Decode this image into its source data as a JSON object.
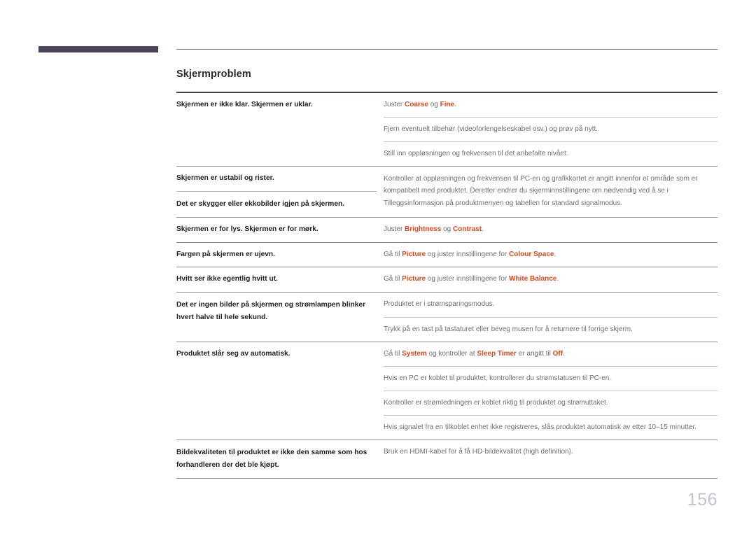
{
  "header": {
    "accent_bar_color": "#4b4259",
    "rule_color": "#7d7d83"
  },
  "page": {
    "title": "Skjermproblem",
    "number": "156",
    "highlight_color": "#e0471b"
  },
  "table": {
    "groups": [
      {
        "questions": [
          "Skjermen er ikke klar. Skjermen er uklar."
        ],
        "answers": [
          [
            {
              "t": "Juster ",
              "hl": false
            },
            {
              "t": "Coarse",
              "hl": true
            },
            {
              "t": " og ",
              "hl": false
            },
            {
              "t": "Fine",
              "hl": true
            },
            {
              "t": ".",
              "hl": false
            }
          ],
          [
            {
              "t": "Fjern eventuelt tilbehør (videoforlengelseskabel osv.) og prøv på nytt.",
              "hl": false
            }
          ],
          [
            {
              "t": "Still inn oppløsningen og frekvensen til det anbefalte nivået.",
              "hl": false
            }
          ]
        ]
      },
      {
        "questions": [
          "Skjermen er ustabil og rister.",
          "Det er skygger eller ekkobilder igjen på skjermen."
        ],
        "answers": [
          [
            {
              "t": "Kontroller at oppløsningen og frekvensen til PC-en og grafikkortet er angitt innenfor et område som er kompatibelt med produktet. Deretter endrer du skjerminnstillingene om nødvendig ved å se i Tilleggsinformasjon på produktmenyen og tabellen for standard signalmodus.",
              "hl": false
            }
          ]
        ]
      },
      {
        "questions": [
          "Skjermen er for lys. Skjermen er for mørk."
        ],
        "answers": [
          [
            {
              "t": "Juster ",
              "hl": false
            },
            {
              "t": "Brightness",
              "hl": true
            },
            {
              "t": " og ",
              "hl": false
            },
            {
              "t": "Contrast",
              "hl": true
            },
            {
              "t": ".",
              "hl": false
            }
          ]
        ]
      },
      {
        "questions": [
          "Fargen på skjermen er ujevn."
        ],
        "answers": [
          [
            {
              "t": "Gå til ",
              "hl": false
            },
            {
              "t": "Picture",
              "hl": true
            },
            {
              "t": " og juster innstillingene for ",
              "hl": false
            },
            {
              "t": "Colour Space",
              "hl": true
            },
            {
              "t": ".",
              "hl": false
            }
          ]
        ]
      },
      {
        "questions": [
          "Hvitt ser ikke egentlig hvitt ut."
        ],
        "answers": [
          [
            {
              "t": "Gå til ",
              "hl": false
            },
            {
              "t": "Picture",
              "hl": true
            },
            {
              "t": " og juster innstillingene for ",
              "hl": false
            },
            {
              "t": "White Balance",
              "hl": true
            },
            {
              "t": ".",
              "hl": false
            }
          ]
        ]
      },
      {
        "questions": [
          "Det er ingen bilder på skjermen og strømlampen blinker hvert halve til hele sekund."
        ],
        "answers": [
          [
            {
              "t": "Produktet er i strømsparingsmodus.",
              "hl": false
            }
          ],
          [
            {
              "t": "Trykk på en tast på tastaturet eller beveg musen for å returnere til forrige skjerm.",
              "hl": false
            }
          ]
        ]
      },
      {
        "questions": [
          "Produktet slår seg av automatisk."
        ],
        "answers": [
          [
            {
              "t": "Gå til ",
              "hl": false
            },
            {
              "t": "System",
              "hl": true
            },
            {
              "t": " og kontroller at ",
              "hl": false
            },
            {
              "t": "Sleep Timer",
              "hl": true
            },
            {
              "t": " er angitt til ",
              "hl": false
            },
            {
              "t": "Off",
              "hl": true
            },
            {
              "t": ".",
              "hl": false
            }
          ],
          [
            {
              "t": "Hvis en PC er koblet til produktet, kontrollerer du strømstatusen til PC-en.",
              "hl": false
            }
          ],
          [
            {
              "t": "Kontroller er strømledningen er koblet riktig til produktet og strømuttaket.",
              "hl": false
            }
          ],
          [
            {
              "t": "Hvis signalet fra en tilkoblet enhet ikke registreres, slås produktet automatisk av etter 10–15 minutter.",
              "hl": false
            }
          ]
        ]
      },
      {
        "questions": [
          "Bildekvaliteten til produktet er ikke den samme som hos forhandleren der det ble kjøpt."
        ],
        "answers": [
          [
            {
              "t": "Bruk en HDMI-kabel for å få HD-bildekvalitet (high definition).",
              "hl": false
            }
          ]
        ]
      }
    ]
  }
}
